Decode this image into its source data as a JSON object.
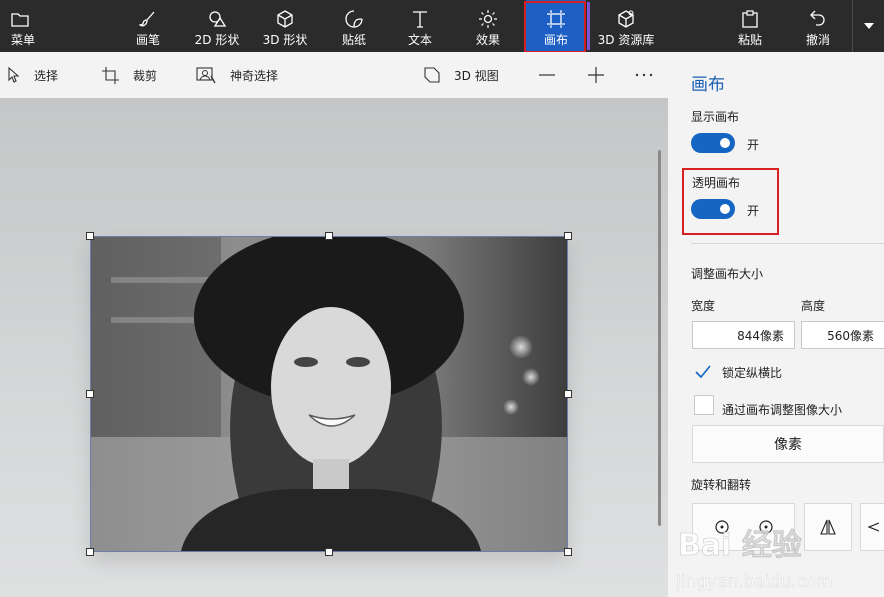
{
  "toolbar": {
    "menu": "菜单",
    "brushes": "画笔",
    "shapes2d": "2D 形状",
    "shapes3d": "3D 形状",
    "stickers": "贴纸",
    "text": "文本",
    "effects": "效果",
    "canvas": "画布",
    "library3d": "3D 资源库",
    "paste": "粘贴",
    "undo": "撤消"
  },
  "subbar": {
    "select": "选择",
    "crop": "裁剪",
    "magic_select": "神奇选择",
    "view3d": "3D 视图"
  },
  "panel": {
    "title": "画布",
    "show_canvas_label": "显示画布",
    "show_canvas_state": "开",
    "transparent_canvas_label": "透明画布",
    "transparent_canvas_state": "开",
    "resize_label": "调整画布大小",
    "width_label": "宽度",
    "height_label": "高度",
    "width_value": "844像素",
    "height_value": "560像素",
    "lock_ratio_label": "锁定纵横比",
    "lock_ratio_checked": true,
    "resize_image_label": "通过画布调整图像大小",
    "resize_image_checked": false,
    "units_button": "像素",
    "rotate_flip_label": "旋转和翻转"
  },
  "watermark": {
    "logo": "Bai 经验",
    "url": "jingyan.baidu.com"
  },
  "colors": {
    "accent": "#1466c2",
    "active_tool": "#1e5fc6",
    "highlight": "#d61f1f"
  }
}
